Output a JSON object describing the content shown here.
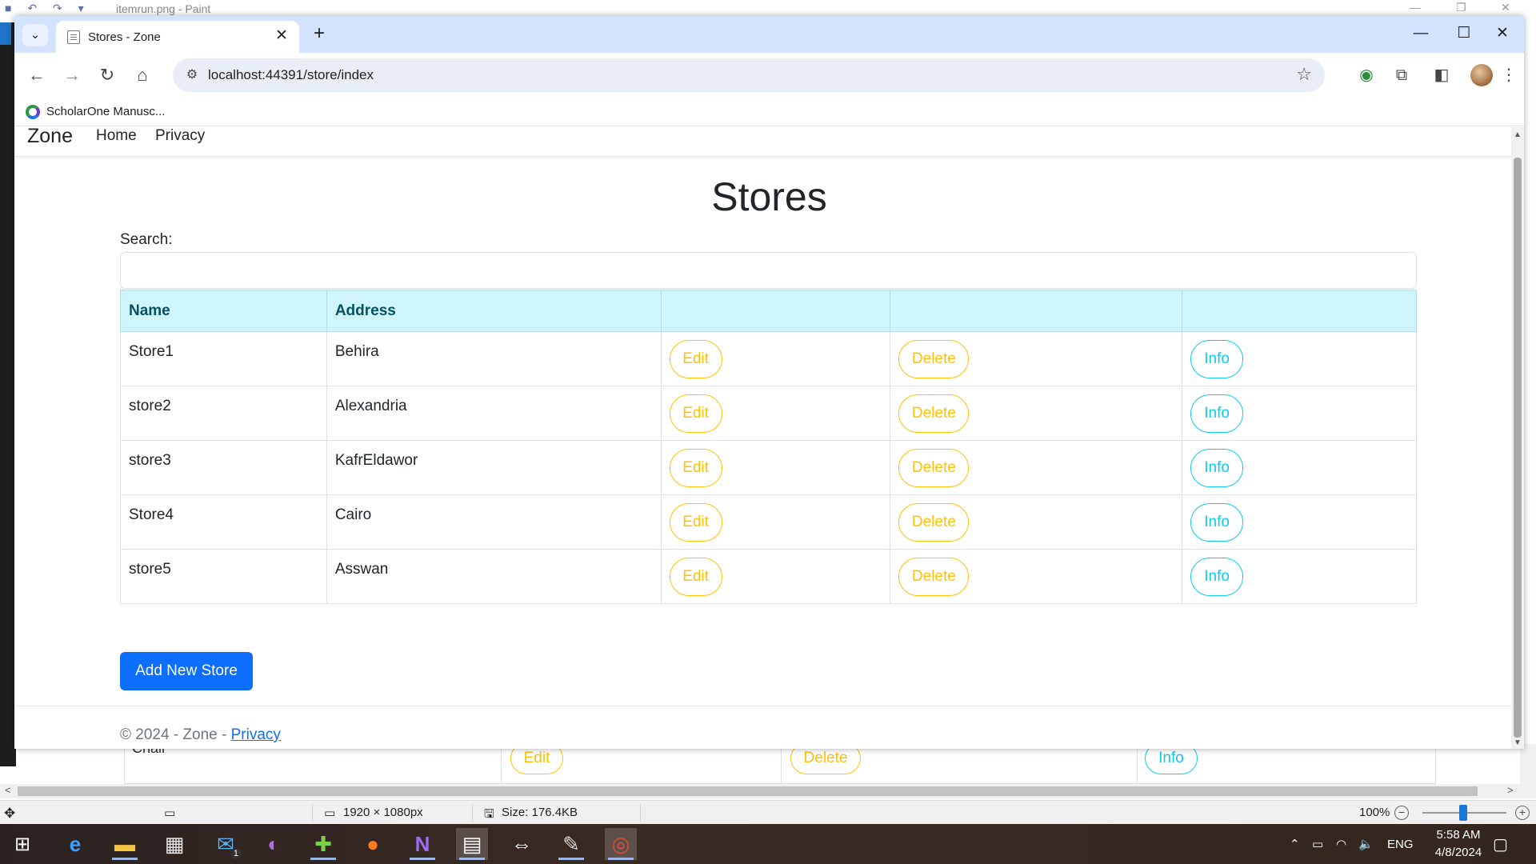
{
  "paint": {
    "title": "itemrun.png - Paint",
    "status": {
      "dimensions": "1920 × 1080px",
      "size": "Size: 176.4KB",
      "zoom": "100%",
      "zoom_level": 1.0
    },
    "peek_row": {
      "name": "Chair",
      "edit": "Edit",
      "delete": "Delete",
      "info": "Info"
    }
  },
  "browser": {
    "tab_title": "Stores - Zone",
    "url": "localhost:44391/store/index",
    "bookmark": "ScholarOne Manusc..."
  },
  "site": {
    "brand": "Zone",
    "nav": [
      "Home",
      "Privacy"
    ],
    "page_title": "Stores",
    "search_label": "Search:",
    "search_value": "",
    "table": {
      "headers": [
        "Name",
        "Address",
        "",
        "",
        ""
      ],
      "rows": [
        {
          "name": "Store1",
          "address": "Behira"
        },
        {
          "name": "store2",
          "address": "Alexandria"
        },
        {
          "name": "store3",
          "address": "KafrEldawor"
        },
        {
          "name": "Store4",
          "address": "Cairo"
        },
        {
          "name": "store5",
          "address": "Asswan"
        }
      ],
      "actions": {
        "edit": "Edit",
        "delete": "Delete",
        "info": "Info"
      }
    },
    "add_button": "Add New Store",
    "footer_text": "© 2024 - Zone - ",
    "footer_link": "Privacy"
  },
  "taskbar": {
    "language": "ENG",
    "time": "5:58 AM",
    "date": "4/8/2024",
    "mail_badge": "1",
    "icons": [
      "windows-start",
      "edge",
      "file-explorer",
      "store",
      "mail",
      "app-mask",
      "app-green",
      "firefox",
      "visual-studio",
      "clapper",
      "teamviewer",
      "paint",
      "chrome"
    ]
  },
  "colors": {
    "warning": "#ffc107",
    "info": "#0dcaf0",
    "primary": "#0d6efd",
    "table_header_bg": "#cff4fc",
    "tabstrip_bg": "#d3e3fd"
  }
}
